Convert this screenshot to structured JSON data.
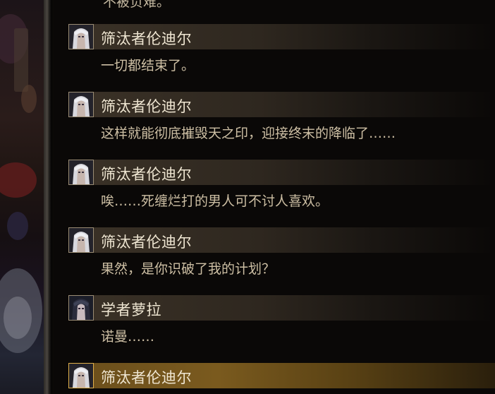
{
  "previous_line": "不被负难。",
  "entries": [
    {
      "speaker": "筛汰者伦迪尔",
      "portrait": "silver-hair-portrait-icon",
      "text": "一切都结束了。",
      "active": false
    },
    {
      "speaker": "筛汰者伦迪尔",
      "portrait": "silver-hair-portrait-icon",
      "text": "这样就能彻底摧毁天之印，迎接终末的降临了……",
      "active": false
    },
    {
      "speaker": "筛汰者伦迪尔",
      "portrait": "silver-hair-portrait-icon",
      "text": "唉……死缠烂打的男人可不讨人喜欢。",
      "active": false
    },
    {
      "speaker": "筛汰者伦迪尔",
      "portrait": "silver-hair-portrait-icon",
      "text": "果然，是你识破了我的计划？",
      "active": false
    },
    {
      "speaker": "学者萝拉",
      "portrait": "dark-hair-portrait-icon",
      "text": "诺曼……",
      "active": false
    },
    {
      "speaker": "筛汰者伦迪尔",
      "portrait": "silver-hair-portrait-icon",
      "text": "",
      "active": true
    }
  ],
  "colors": {
    "header_bg": "#3b3227",
    "active_header_bg": "#7a5a1e",
    "name_text": "#efe6d2",
    "dialog_text": "#cdbfa4"
  }
}
